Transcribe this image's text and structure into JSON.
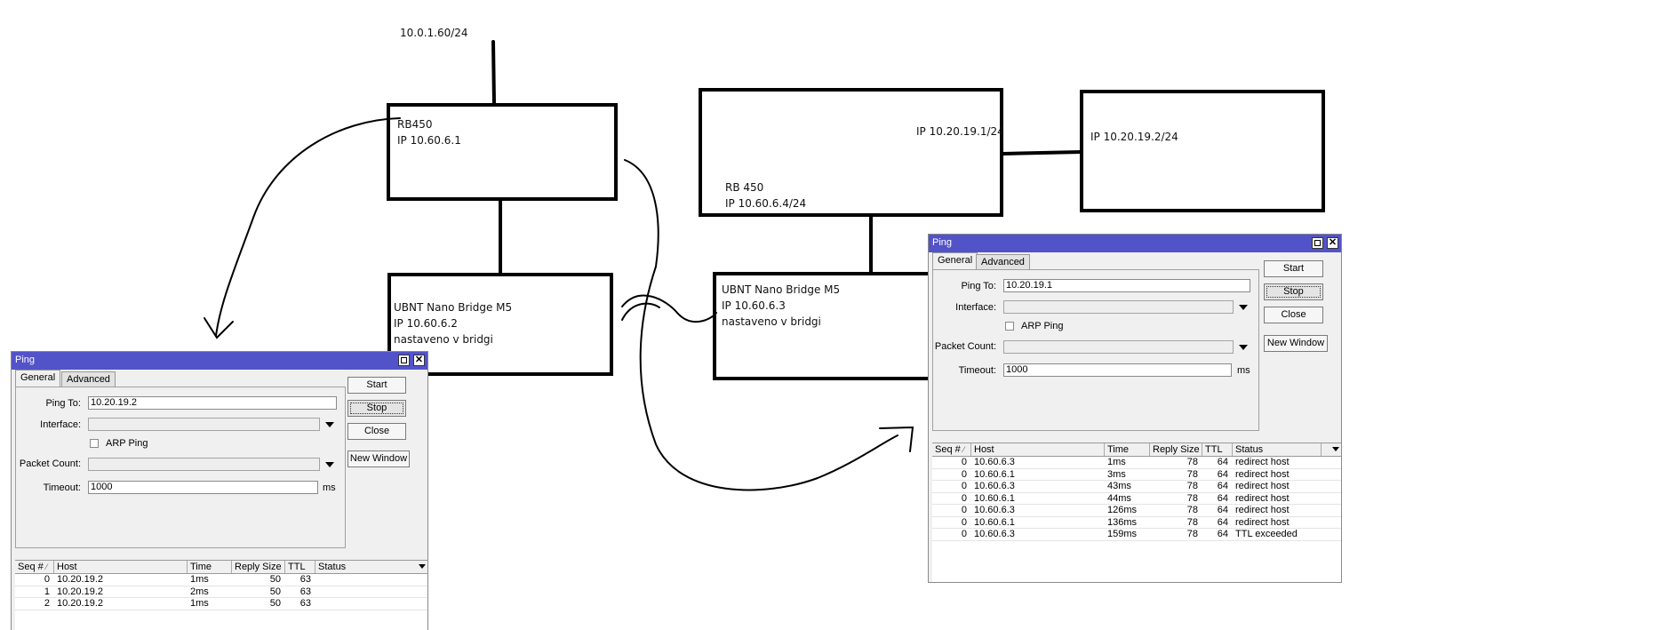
{
  "diagram": {
    "uplink_ip": "10.0.1.60/24",
    "rb450_left": {
      "name": "RB450",
      "ip": "IP 10.60.6.1"
    },
    "nano_left": {
      "name": "UBNT Nano Bridge M5",
      "ip": "IP 10.60.6.2",
      "note": "nastaveno v bridgi"
    },
    "rb450_right": {
      "name": "RB 450",
      "ip": "IP 10.60.6.4/24",
      "wan_ip": "IP 10.20.19.1/24"
    },
    "remote_box": {
      "ip": "IP 10.20.19.2/24"
    },
    "nano_right": {
      "name": "UBNT Nano Bridge M5",
      "ip": "IP 10.60.6.3",
      "note": "nastaveno v bridgi"
    }
  },
  "ping_left": {
    "title": "Ping",
    "tabs": [
      "General",
      "Advanced"
    ],
    "labels": {
      "ping_to": "Ping To:",
      "interface": "Interface:",
      "arp": "ARP Ping",
      "packet_count": "Packet Count:",
      "timeout": "Timeout:",
      "ms": "ms"
    },
    "values": {
      "ping_to": "10.20.19.2",
      "interface": "",
      "packet_count": "",
      "timeout": "1000"
    },
    "buttons": {
      "start": "Start",
      "stop": "Stop",
      "close": "Close",
      "new_window": "New Window"
    },
    "columns": [
      "Seq #",
      "Host",
      "Time",
      "Reply Size",
      "TTL",
      "Status"
    ],
    "rows": [
      {
        "seq": "0",
        "host": "10.20.19.2",
        "time": "1ms",
        "size": "50",
        "ttl": "63",
        "status": ""
      },
      {
        "seq": "1",
        "host": "10.20.19.2",
        "time": "2ms",
        "size": "50",
        "ttl": "63",
        "status": ""
      },
      {
        "seq": "2",
        "host": "10.20.19.2",
        "time": "1ms",
        "size": "50",
        "ttl": "63",
        "status": ""
      }
    ]
  },
  "ping_right": {
    "title": "Ping",
    "tabs": [
      "General",
      "Advanced"
    ],
    "labels": {
      "ping_to": "Ping To:",
      "interface": "Interface:",
      "arp": "ARP Ping",
      "packet_count": "Packet Count:",
      "timeout": "Timeout:",
      "ms": "ms"
    },
    "values": {
      "ping_to": "10.20.19.1",
      "interface": "",
      "packet_count": "",
      "timeout": "1000"
    },
    "buttons": {
      "start": "Start",
      "stop": "Stop",
      "close": "Close",
      "new_window": "New Window"
    },
    "columns": [
      "Seq #",
      "Host",
      "Time",
      "Reply Size",
      "TTL",
      "Status"
    ],
    "rows": [
      {
        "seq": "0",
        "host": "10.60.6.3",
        "time": "1ms",
        "size": "78",
        "ttl": "64",
        "status": "redirect host"
      },
      {
        "seq": "0",
        "host": "10.60.6.1",
        "time": "3ms",
        "size": "78",
        "ttl": "64",
        "status": "redirect host"
      },
      {
        "seq": "0",
        "host": "10.60.6.3",
        "time": "43ms",
        "size": "78",
        "ttl": "64",
        "status": "redirect host"
      },
      {
        "seq": "0",
        "host": "10.60.6.1",
        "time": "44ms",
        "size": "78",
        "ttl": "64",
        "status": "redirect host"
      },
      {
        "seq": "0",
        "host": "10.60.6.3",
        "time": "126ms",
        "size": "78",
        "ttl": "64",
        "status": "redirect host"
      },
      {
        "seq": "0",
        "host": "10.60.6.1",
        "time": "136ms",
        "size": "78",
        "ttl": "64",
        "status": "redirect host"
      },
      {
        "seq": "0",
        "host": "10.60.6.3",
        "time": "159ms",
        "size": "78",
        "ttl": "64",
        "status": "TTL exceeded"
      }
    ]
  }
}
